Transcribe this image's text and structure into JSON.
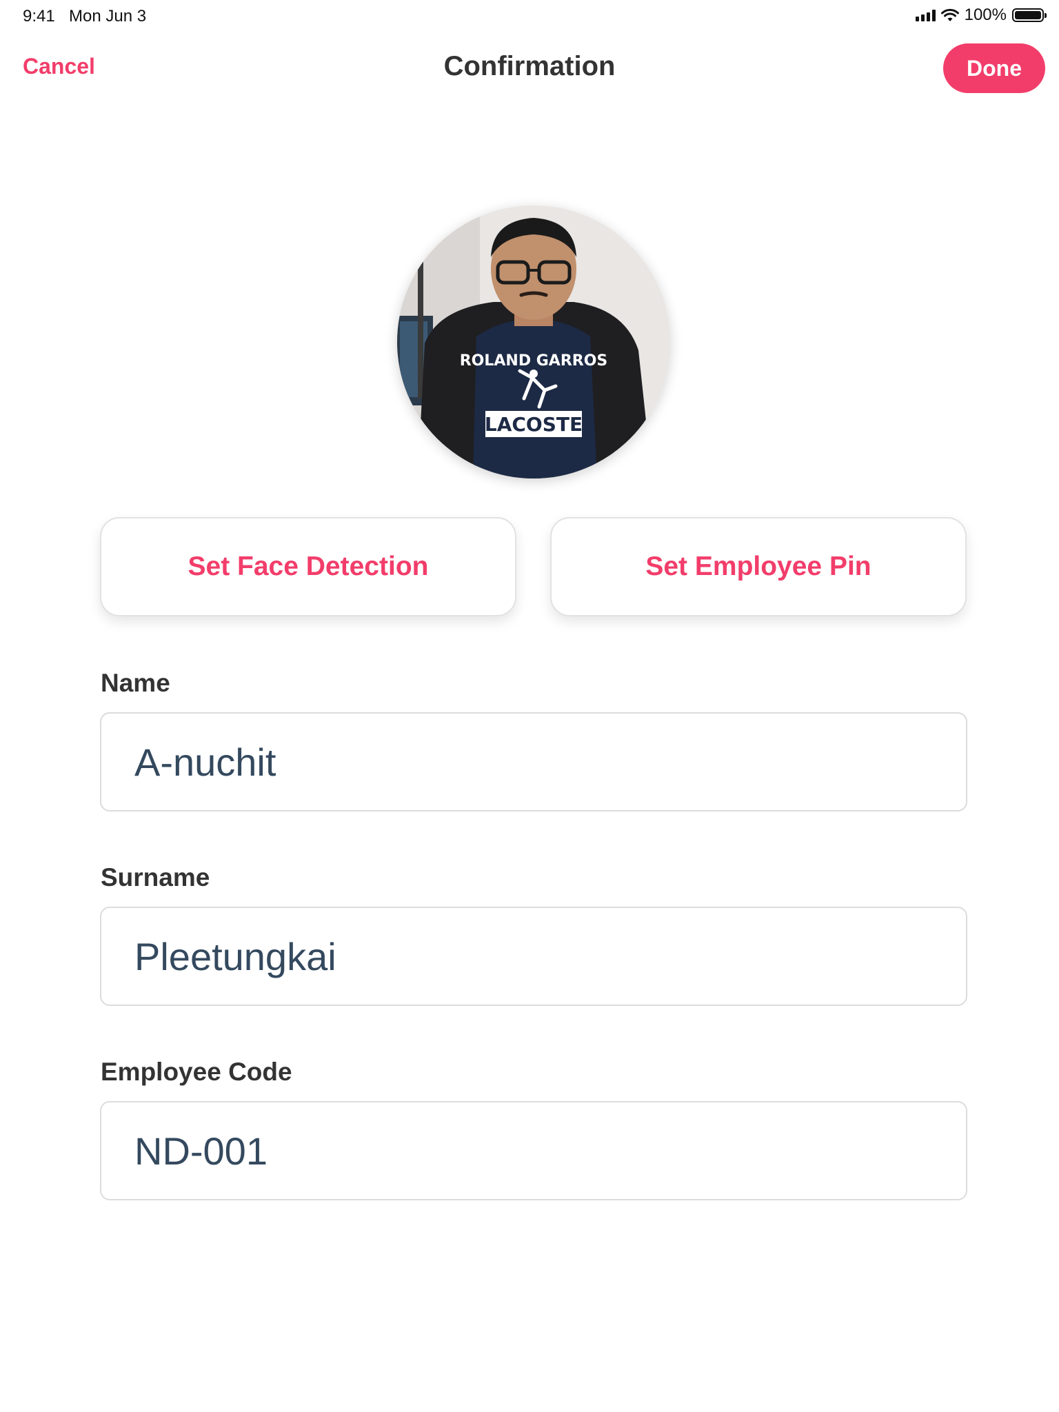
{
  "status_bar": {
    "time": "9:41",
    "date": "Mon Jun 3",
    "battery_percent": "100%",
    "battery_level": 1.0
  },
  "nav": {
    "cancel_label": "Cancel",
    "title": "Confirmation",
    "done_label": "Done"
  },
  "avatar": {
    "alt": "Employee photo",
    "shirt_text_line1": "ROLAND GARROS",
    "shirt_text_line2": "LACOSTE"
  },
  "actions": {
    "face_detection_label": "Set Face Detection",
    "employee_pin_label": "Set Employee Pin"
  },
  "form": {
    "name": {
      "label": "Name",
      "value": "A-nuchit"
    },
    "surname": {
      "label": "Surname",
      "value": "Pleetungkai"
    },
    "employee_code": {
      "label": "Employee Code",
      "value": "ND-001"
    }
  },
  "colors": {
    "accent": "#f23d6a",
    "title_text": "#333333",
    "input_text": "#34495e",
    "border": "#dcdcdc"
  },
  "icons": [
    "signal-icon",
    "wifi-icon",
    "battery-icon"
  ]
}
